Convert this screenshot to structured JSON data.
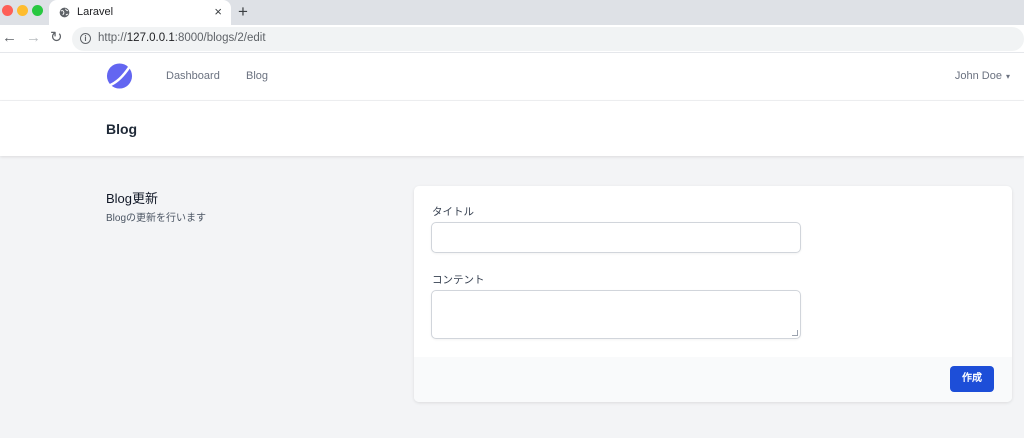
{
  "browser": {
    "tab_title": "Laravel",
    "tab_close": "×",
    "new_tab": "+",
    "url_scheme": "http://",
    "url_host": "127.0.0.1",
    "url_rest": ":8000/blogs/2/edit",
    "icons": {
      "back": "back-arrow-icon",
      "forward": "forward-arrow-icon",
      "reload": "reload-icon",
      "info": "info-icon",
      "favicon": "globe-icon"
    }
  },
  "nav": {
    "links": [
      "Dashboard",
      "Blog"
    ],
    "user": "John Doe",
    "logo_color": "#6366f1"
  },
  "header": {
    "title": "Blog"
  },
  "section": {
    "title": "Blog更新",
    "description": "Blogの更新を行います"
  },
  "form": {
    "title_label": "タイトル",
    "title_value": "",
    "content_label": "コンテント",
    "content_value": "",
    "submit_label": "作成",
    "submit_color": "#1d4ed8"
  }
}
